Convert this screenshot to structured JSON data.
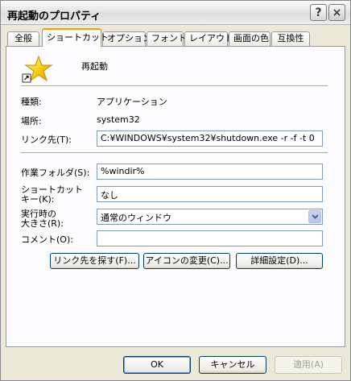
{
  "window": {
    "title": "再起動のプロパティ",
    "help_glyph": "?",
    "close_glyph": "×"
  },
  "tabs": [
    {
      "label": "全般"
    },
    {
      "label": "ショートカット"
    },
    {
      "label": "オプション"
    },
    {
      "label": "フォント"
    },
    {
      "label": "レイアウト"
    },
    {
      "label": "画面の色"
    },
    {
      "label": "互換性"
    }
  ],
  "shortcut": {
    "name": "再起動",
    "icon": "star-icon",
    "type_label": "種類:",
    "type_value": "アプリケーション",
    "location_label": "場所:",
    "location_value": "system32",
    "target_label": "リンク先(T):",
    "target_value": "C:¥WINDOWS¥system32¥shutdown.exe -r -f -t 0",
    "start_in_label": "作業フォルダ(S):",
    "start_in_value": "%windir%",
    "hotkey_label_1": "ショートカット",
    "hotkey_label_2": "キー(K):",
    "hotkey_value": "なし",
    "run_label_1": "実行時の",
    "run_label_2": "大きさ(R):",
    "run_value": "通常のウィンドウ",
    "comment_label": "コメント(O):",
    "comment_value": ""
  },
  "actions": {
    "find_target": "リンク先を探す(F)...",
    "change_icon": "アイコンの変更(C)...",
    "advanced": "詳細設定(D)..."
  },
  "footer": {
    "ok": "OK",
    "cancel": "キャンセル",
    "apply": "適用(A)"
  }
}
